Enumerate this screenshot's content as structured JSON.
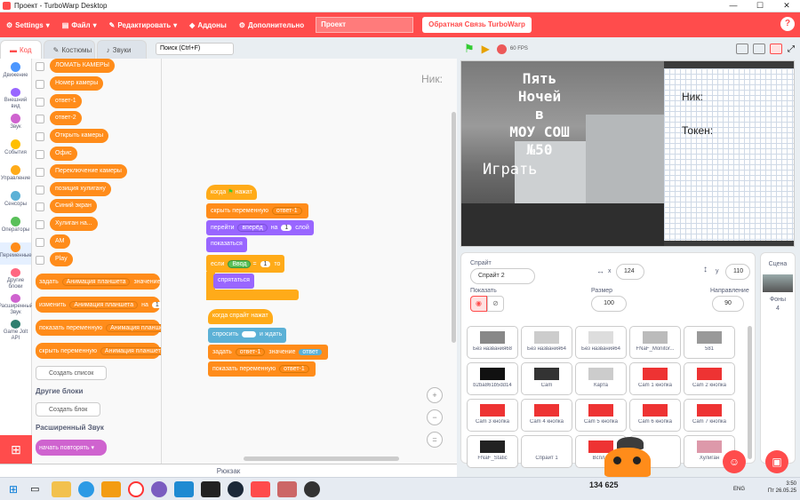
{
  "window": {
    "title": "Проект - TurboWarp Desktop",
    "controls": [
      "—",
      "☐",
      "✕"
    ]
  },
  "menu": {
    "settings": "Settings",
    "file": "Файл",
    "edit": "Редактировать",
    "addons": "Аддоны",
    "advanced": "Дополнительно",
    "project_title": "Проект",
    "feedback": "Обратная Связь TurboWarp",
    "help": "?"
  },
  "tabs": {
    "code": "Код",
    "costumes": "Костюмы",
    "sounds": "Звуки"
  },
  "search": {
    "placeholder": "Поиск (Ctrl+F)"
  },
  "categories": [
    {
      "label": "Движение",
      "color": "#4c97ff"
    },
    {
      "label": "Внешний вид",
      "color": "#9966ff"
    },
    {
      "label": "Звук",
      "color": "#cf63cf"
    },
    {
      "label": "События",
      "color": "#ffbf00"
    },
    {
      "label": "Управление",
      "color": "#ffab19"
    },
    {
      "label": "Сенсоры",
      "color": "#5cb1d6"
    },
    {
      "label": "Операторы",
      "color": "#59c059"
    },
    {
      "label": "Переменные",
      "color": "#ff8c1a"
    },
    {
      "label": "Другие блоки",
      "color": "#ff6680"
    },
    {
      "label": "Расширенный Звук",
      "color": "#cf63cf"
    },
    {
      "label": "Game Jolt API",
      "color": "#2f7f6f"
    }
  ],
  "palette": {
    "variables": [
      "ЛОМАТЬ КАМЕРЫ",
      "Номер камеры",
      "ответ-1",
      "ответ-2",
      "Открыть камеры",
      "Офис",
      "Переключение камеры",
      "позиция хулигану",
      "Синий экран",
      "Хулиган на...",
      "AM",
      "Play"
    ],
    "list_set": "задать",
    "list_set_name": "Анимация планшета",
    "list_set_to": "значение",
    "list_set_val": "",
    "list_change": "изменить",
    "list_change_name": "Анимация планшета",
    "list_change_by": "на",
    "list_change_val": "1",
    "list_show": "показать переменную",
    "list_show_name": "Анимация планшета",
    "list_hide": "скрыть переменную",
    "list_hide_name": "Анимация планшета",
    "make_list": "Создать список",
    "other_blocks": "Другие блоки",
    "make_block": "Создать блок",
    "ext_sound": "Расширенный Звук",
    "ext_block": "начать повторять"
  },
  "script": {
    "when_flag": "когда",
    "when_flag_2": "нажат",
    "hide_var": "скрыть переменную",
    "hide_var_name": "ответ-1",
    "go": "перейти",
    "go_dir": "вперёд",
    "go_on": "на",
    "go_num": "1",
    "go_layer": "слой",
    "show": "показаться",
    "if": "если",
    "if_input": "Ввод",
    "if_eq": "=",
    "if_val": "1",
    "if_then": "то",
    "hide": "спрятаться",
    "sprite_clicked": "когда спрайт нажат",
    "ask": "спросить",
    "ask_wait": "и ждать",
    "set": "задать",
    "set_var": "ответ-1",
    "set_to": "значение",
    "set_val": "ответ",
    "show_var": "показать переменную",
    "show_var_name": "ответ-1"
  },
  "workspace_label": "Ник:",
  "zoom": {
    "in": "+",
    "out": "−",
    "reset": "="
  },
  "backpack": "Рюкзак",
  "stage_controls": {
    "fps": "60 FPS"
  },
  "stage": {
    "title": "Пять\nНочей\nв\nМОУ СОШ\n№50",
    "play": "Играть",
    "nick": "Ник:",
    "token": "Токен:"
  },
  "sprite_info": {
    "sprite_label": "Спрайт",
    "sprite_name": "Спрайт 2",
    "x_label": "x",
    "x": "124",
    "y_label": "y",
    "y": "110",
    "show_label": "Показать",
    "size_label": "Размер",
    "size": "100",
    "dir_label": "Направление",
    "dir": "90"
  },
  "sprites": [
    {
      "name": "Без названия68"
    },
    {
      "name": "Без названия64"
    },
    {
      "name": "Без названия64"
    },
    {
      "name": "FNaF_Monitor..."
    },
    {
      "name": "581"
    },
    {
      "name": "b2ba861b5dd14"
    },
    {
      "name": "Cam"
    },
    {
      "name": "Карта"
    },
    {
      "name": "Cam 1 кнопка"
    },
    {
      "name": "Cam 2 кнопка"
    },
    {
      "name": "Cam 3 кнопка"
    },
    {
      "name": "Cam 4 кнопка"
    },
    {
      "name": "Cam 5 кнопка"
    },
    {
      "name": "Cam 6 кнопка"
    },
    {
      "name": "Cam 7 кнопка"
    },
    {
      "name": "FNaF_Static"
    },
    {
      "name": "Спрайт 1"
    },
    {
      "name": "Вспл..."
    },
    {
      "name": ""
    },
    {
      "name": "Хулиган"
    }
  ],
  "stage_panel": {
    "label": "Сцена",
    "backdrops_label": "Фоны",
    "backdrops": "4"
  },
  "taskbar": {
    "counter": "134 625",
    "lang": "ENG",
    "time": "3:50",
    "date": "Пт 26.05.25"
  }
}
